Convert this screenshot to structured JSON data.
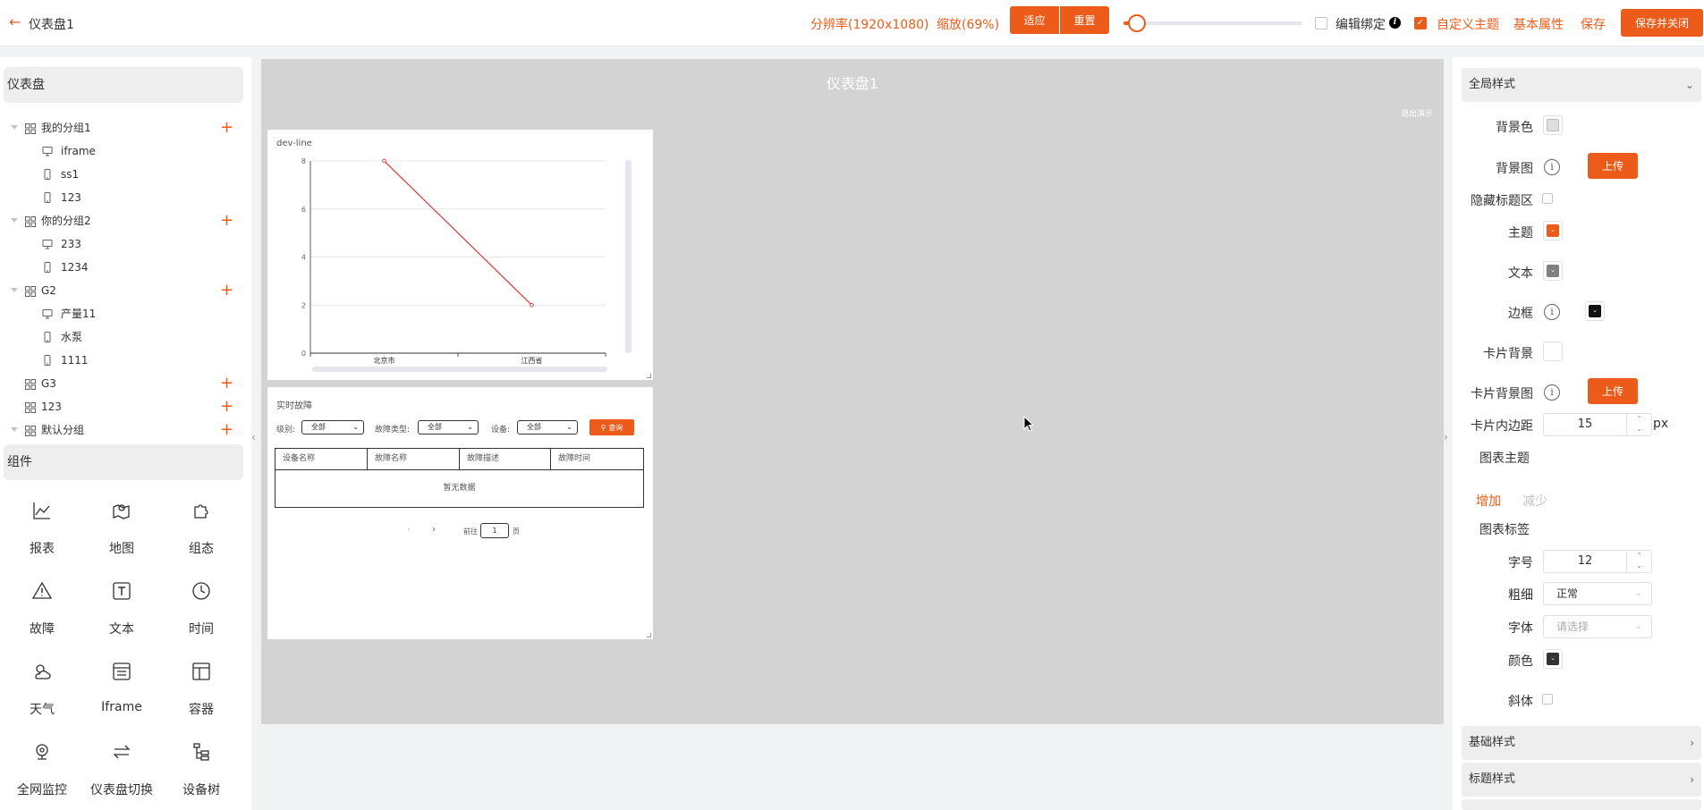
{
  "header": {
    "back_icon": "arrow-left-icon",
    "title": "仪表盘1",
    "resolution": "分辨率(1920x1080)",
    "zoom": "缩放(69%)",
    "fit_label": "适应",
    "reset_label": "重置",
    "zoom_slider_level": 0.05,
    "edit_bind_label": "编辑绑定",
    "edit_bind_checked": false,
    "custom_theme_label": "自定义主题",
    "custom_theme_checked": true,
    "basic_props_label": "基本属性",
    "save_label": "保存",
    "save_close_label": "保存并关闭",
    "accent": "#ec5b19"
  },
  "sidebar": {
    "dashboard_heading": "仪表盘",
    "groups": [
      {
        "label": "我的分组1",
        "expanded": true,
        "children": [
          {
            "label": "iframe",
            "icon": "monitor-icon"
          },
          {
            "label": "ss1",
            "icon": "phone-icon"
          },
          {
            "label": "123",
            "icon": "phone-icon"
          }
        ]
      },
      {
        "label": "你的分组2",
        "expanded": true,
        "children": [
          {
            "label": "233",
            "icon": "monitor-icon"
          },
          {
            "label": "1234",
            "icon": "phone-icon"
          }
        ]
      },
      {
        "label": "G2",
        "expanded": true,
        "children": [
          {
            "label": "产量11",
            "icon": "monitor-icon"
          },
          {
            "label": "水泵",
            "icon": "phone-icon"
          },
          {
            "label": "1111",
            "icon": "phone-icon"
          }
        ]
      },
      {
        "label": "G3",
        "expanded": false,
        "children": []
      },
      {
        "label": "123",
        "expanded": false,
        "children": []
      },
      {
        "label": "默认分组",
        "expanded": true,
        "children": []
      }
    ],
    "components_heading": "组件",
    "components": [
      {
        "label": "报表",
        "icon": "line-chart-icon"
      },
      {
        "label": "地图",
        "icon": "map-icon"
      },
      {
        "label": "组态",
        "icon": "puzzle-icon"
      },
      {
        "label": "故障",
        "icon": "warning-icon"
      },
      {
        "label": "文本",
        "icon": "text-icon"
      },
      {
        "label": "时间",
        "icon": "clock-icon"
      },
      {
        "label": "天气",
        "icon": "weather-icon"
      },
      {
        "label": "Iframe",
        "icon": "iframe-icon"
      },
      {
        "label": "容器",
        "icon": "layout-icon"
      },
      {
        "label": "全网监控",
        "icon": "camera-icon"
      },
      {
        "label": "仪表盘切换",
        "icon": "switch-icon"
      },
      {
        "label": "设备树",
        "icon": "tree-icon"
      }
    ]
  },
  "canvas": {
    "title": "仪表盘1",
    "exit_label": "退出演示",
    "chart_card": {
      "title": "dev-line"
    },
    "fault_card": {
      "title": "实时故障",
      "level_label": "级别:",
      "level_value": "全部",
      "type_label": "故障类型:",
      "type_value": "全部",
      "device_label": "设备:",
      "device_value": "全部",
      "query_label": "查询",
      "columns": [
        "设备名称",
        "故障名称",
        "故障描述",
        "故障时间"
      ],
      "empty_text": "暂无数据",
      "goto_label": "前往",
      "page_value": "1",
      "page_unit": "页"
    }
  },
  "chart_data": {
    "type": "line",
    "x": [
      "北京市",
      "江西省"
    ],
    "series": [
      {
        "values": [
          8,
          2
        ],
        "color": "#d94a4a"
      }
    ],
    "ylim": [
      0,
      8
    ],
    "yticks": [
      "0",
      "2",
      "4",
      "6",
      "8"
    ],
    "grid": true
  },
  "panel": {
    "global_style": "全局样式",
    "bg_color_label": "背景色",
    "bg_color": "#e0e0e0",
    "bg_image_label": "背景图",
    "upload_label": "上传",
    "hide_title_label": "隐藏标题区",
    "hide_title_checked": false,
    "theme_label": "主题",
    "theme_color": "#ec5b19",
    "text_label": "文本",
    "text_color": "#808080",
    "border_label": "边框",
    "border_color": "#111111",
    "card_bg_label": "卡片背景",
    "card_bg_color": "#ffffff",
    "card_bg_image_label": "卡片背景图",
    "card_padding_label": "卡片内边距",
    "card_padding": "15",
    "px_unit": "px",
    "chart_theme_label": "图表主题",
    "add_label": "增加",
    "reduce_label": "减少",
    "chart_tag_label": "图表标签",
    "font_size_label": "字号",
    "font_size": "12",
    "weight_label": "粗细",
    "weight_value": "正常",
    "font_label": "字体",
    "font_placeholder": "请选择",
    "color_label": "颜色",
    "tag_color": "#333333",
    "italic_label": "斜体",
    "italic_checked": false,
    "basic_style": "基础样式",
    "title_style": "标题样式"
  }
}
